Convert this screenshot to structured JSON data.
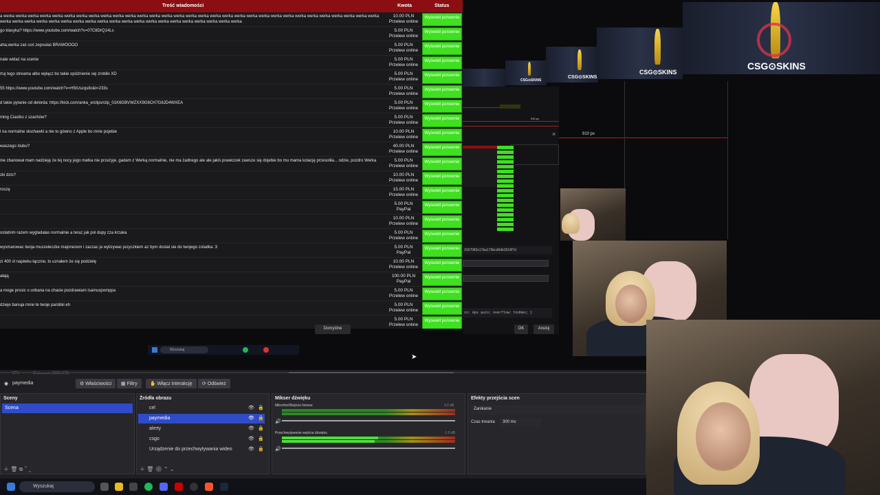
{
  "table": {
    "headers": {
      "message": "Treść wiadomości",
      "amount": "Kwota",
      "status": "Status"
    },
    "rows": [
      {
        "msg": "a werka werka werka werka werka werka werka werka werka werka werka werka werka werka werka werka werka werka werka werka werka werka werka werka werka werka werka werka werka werka werka werka werka werka werka werka werka werka werka werka werka werka werka werka werka werka werka werka werka werka werka",
        "amt": "10.00 PLN",
        "method": "Przelew online"
      },
      {
        "msg": "go klasyka? https://www.youtube.com/watch?v=07C8DrQ14Ls",
        "amt": "5.00 PLN",
        "method": "Przelew online"
      },
      {
        "msg": "aha,werka zaś coś zepsułaś BRAWOOOO",
        "amt": "5.00 PLN",
        "method": "Przelew online"
      },
      {
        "msg": "nate widać na scenie",
        "amt": "5.00 PLN",
        "method": "Przelew online"
      },
      {
        "msg": "rtuj tego streama albo wyłącz bo takie opóźnienie się zrobiło XD",
        "amt": "5.00 PLN",
        "method": "Przelew online"
      },
      {
        "msg": "55 https://www.youtube.com/watch?v=H5tUszqsIlo&t=233s",
        "amt": "5.00 PLN",
        "method": "Przelew online"
      },
      {
        "msg": "d takie pytanie od delorda: https://kick.com/anka_e/clips/clip_01K6GBVWZXX9G6CH7G8JD4WXEA",
        "amt": "5.00 PLN",
        "method": "Przelew online"
      },
      {
        "msg": "ming Ciastko z szachów?",
        "amt": "5.00 PLN",
        "method": "Przelew online"
      },
      {
        "msg": "l na normalne słuchawki a nie to gówno z Apple bo mnie pojebie",
        "amt": "10.00 PLN",
        "method": "Przelew online"
      },
      {
        "msg": "waszego ślubu?",
        "amt": "40.00 PLN",
        "method": "Przelew online"
      },
      {
        "msg": "nie zbanował mam nadzieję że tej nocy jego matka nie przeżyje, gadam z Werką normalnie, nie ma żadnego ale ale jakiś prawiczek zawsze się dojebie bo mu mama kolację przesoliła... odzie, pozdro Werka",
        "amt": "5.00 PLN",
        "method": "Przelew online"
      },
      {
        "msg": "zki dzis?",
        "amt": "10.00 PLN",
        "method": "Przelew online"
      },
      {
        "msg": "roszę",
        "amt": "15.00 PLN",
        "method": "Przelew online"
      },
      {
        "msg": "",
        "amt": "5.00 PLN",
        "method": "PayPal"
      },
      {
        "msg": "",
        "amt": "10.00 PLN",
        "method": "Przelew online"
      },
      {
        "msg": "ostatnim razem wygladalas normalnie a teraz jak pol dupy zza krzaka",
        "amt": "5.00 PLN",
        "method": "Przelew online"
      },
      {
        "msg": "wysmarowac twoja muszeleczke majonezem i zaczac ja wylizywac jezyczkiem az bym dostal sie do twojego zoladka :3",
        "amt": "5.00 PLN",
        "method": "PayPal"
      },
      {
        "msg": "zi 400 zł napiwku łącznie, to uznałem że się podzielę",
        "amt": "10.00 PLN",
        "method": "Przelew online"
      },
      {
        "msg": "ałają",
        "amt": "100.00 PLN",
        "method": "PayPal"
      },
      {
        "msg": "a moge prosic o unbana na chacie pozdrawiam isamuxpomppa",
        "amt": "5.00 PLN",
        "method": "Przelew online"
      },
      {
        "msg": "dzieje banuja mnie te twoje parobki eh",
        "amt": "5.00 PLN",
        "method": "Przelew online"
      },
      {
        "msg": "",
        "amt": "5.00 PLN",
        "method": "Przelew online"
      }
    ],
    "status_label": "Wyświetl ponownie"
  },
  "overlay": {
    "logo": "CSG⊙SKINS",
    "measure": "910 px",
    "measure_small": "910 px",
    "hash": "3167083c17ba179bcd0db3518f7d",
    "css_text": "in: 0px auto; overflow: hidden; }",
    "btn_defaults": "Domyślne",
    "btn_ok": "OK",
    "btn_cancel": "Anuluj",
    "search_small": "Wyszukaj"
  },
  "obs": {
    "zoom": "87%",
    "scaling": "Skalowanie (1888x948)",
    "selected_source": "paymedia",
    "buttons": {
      "props": "Właściwości",
      "filters": "Filtry",
      "interact": "Włącz interakcję",
      "refresh": "Odśwież"
    },
    "scenes": {
      "title": "Sceny",
      "items": [
        "Scena"
      ]
    },
    "sources": {
      "title": "Źródła obrazu",
      "items": [
        "cel",
        "paymedia",
        "alerty",
        "csgo",
        "Urządzenie do przechwytywania wideo"
      ]
    },
    "mixer": {
      "title": "Mikser dźwięku",
      "channels": [
        {
          "name": "Mikrofon/Wejście liniowe",
          "db": "0.0 dB"
        },
        {
          "name": "Przechwytywanie wejścia dźwięku",
          "db": "-1.0 dB"
        }
      ],
      "scale": [
        "-60",
        "-55",
        "-50",
        "-45",
        "-40",
        "-35",
        "-30",
        "-25",
        "-20",
        "-15",
        "-10",
        "-5",
        "0"
      ]
    },
    "transitions": {
      "title": "Efekty przejścia scen",
      "type": "Zanikanie",
      "duration_label": "Czas trwania",
      "duration_value": "300 ms"
    }
  },
  "taskbar": {
    "search": "Wyszukaj"
  },
  "colors": {
    "header": "#8b0f12",
    "status_green": "#3ee01f",
    "obs_bg": "#1f1f23",
    "selection": "#2f4bc8"
  }
}
